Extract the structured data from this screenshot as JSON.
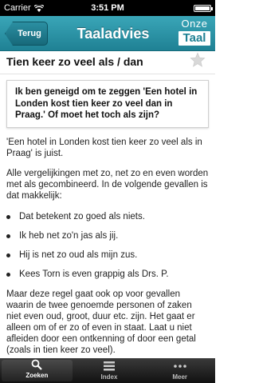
{
  "status": {
    "carrier": "Carrier",
    "time": "3:51 PM"
  },
  "navbar": {
    "back_label": "Terug",
    "title": "Taaladvies",
    "logo_top": "Onze",
    "logo_bottom": "Taal"
  },
  "page": {
    "title": "Tien keer zo veel als / dan"
  },
  "question": "Ik ben geneigd om te zeggen 'Een hotel in Londen kost tien keer zo veel dan in Praag.' Of moet het toch als zijn?",
  "answer": "'Een hotel in Londen kost tien keer zo veel als in Praag' is juist.",
  "explanation": "Alle vergelijkingen met zo, net zo en even worden met als gecombineerd. In de volgende gevallen is dat makkelijk:",
  "examples": [
    "Dat betekent zo goed als niets.",
    "Ik heb net zo'n jas als jij.",
    "Hij is net zo oud als mijn zus.",
    "Kees Torn is even grappig als Drs. P."
  ],
  "followup": "Maar deze regel gaat ook op voor gevallen waarin de twee genoemde personen of zaken niet even oud, groot, duur etc. zijn. Het gaat er alleen om of er zo of even in staat. Laat u niet afleiden door een ontkenning of door een getal (zoals in tien keer zo veel).",
  "tabs": [
    {
      "label": "Zoeken",
      "icon": "search-icon"
    },
    {
      "label": "Index",
      "icon": "list-icon"
    },
    {
      "label": "Meer",
      "icon": "more-icon"
    }
  ],
  "colors": {
    "accent": "#2b95a8",
    "tabbar": "#1a1a1a"
  }
}
